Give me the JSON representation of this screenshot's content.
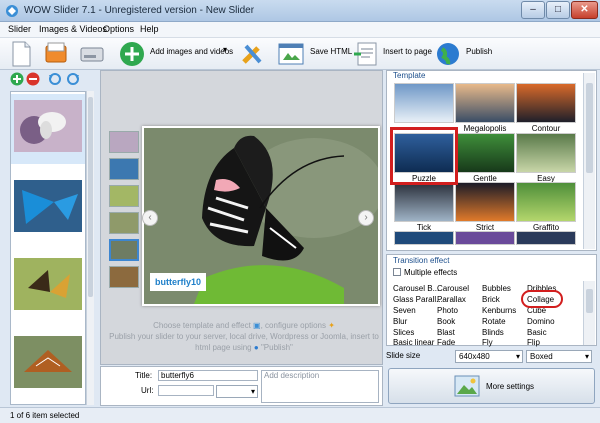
{
  "window": {
    "title": "WOW Slider 7.1 - Unregistered version - New Slider",
    "min": "–",
    "max": "□",
    "close": "✕"
  },
  "menu": [
    "Slider",
    "Images & Videos",
    "Options",
    "Help"
  ],
  "toolbar": {
    "add_images": "Add images and videos",
    "save_html": "Save HTML",
    "insert": "Insert to page",
    "publish": "Publish"
  },
  "preview": {
    "caption": "butterfly10",
    "prev": "‹",
    "next": "›",
    "hint1": "Choose template and effect",
    "hint1b": ", configure options",
    "hint2": "Publish your slider to your server, local drive, Wordpress or Joomla, insert to",
    "hint3": "html page using",
    "hint3b": "\"Publish\""
  },
  "properties": {
    "title_label": "Title:",
    "title_value": "butterfly6",
    "url_label": "Url:",
    "url_value": "",
    "description_placeholder": "Add description"
  },
  "template_panel": {
    "title": "Template",
    "items": [
      "Megalopolis",
      "Contour",
      "Puzzle",
      "Gentle",
      "Easy",
      "Tick",
      "Strict",
      "Graffito"
    ],
    "selected": "Puzzle"
  },
  "effects_panel": {
    "title": "Transition effect",
    "multiple": "Multiple effects",
    "columns": [
      [
        "Carousel B...",
        "Glass Parall...",
        "Seven",
        "Blur",
        "Slices",
        "Basic linear"
      ],
      [
        "Carousel",
        "Parallax",
        "Photo",
        "Book",
        "Blast",
        "Fade"
      ],
      [
        "Bubbles",
        "Brick",
        "Kenburns",
        "Rotate",
        "Blinds",
        "Fly"
      ],
      [
        "Dribbles",
        "Collage",
        "Cube",
        "Domino",
        "Basic",
        "Flip"
      ]
    ],
    "selected": "Collage"
  },
  "slide_size": {
    "label": "Slide size",
    "size": "640x480",
    "mode": "Boxed"
  },
  "more_settings": "More settings",
  "status": "1 of 6 item selected",
  "colors": {
    "accent": "#1e7fc9",
    "highlight": "#d21e1e",
    "add_green": "#2fa84f"
  }
}
